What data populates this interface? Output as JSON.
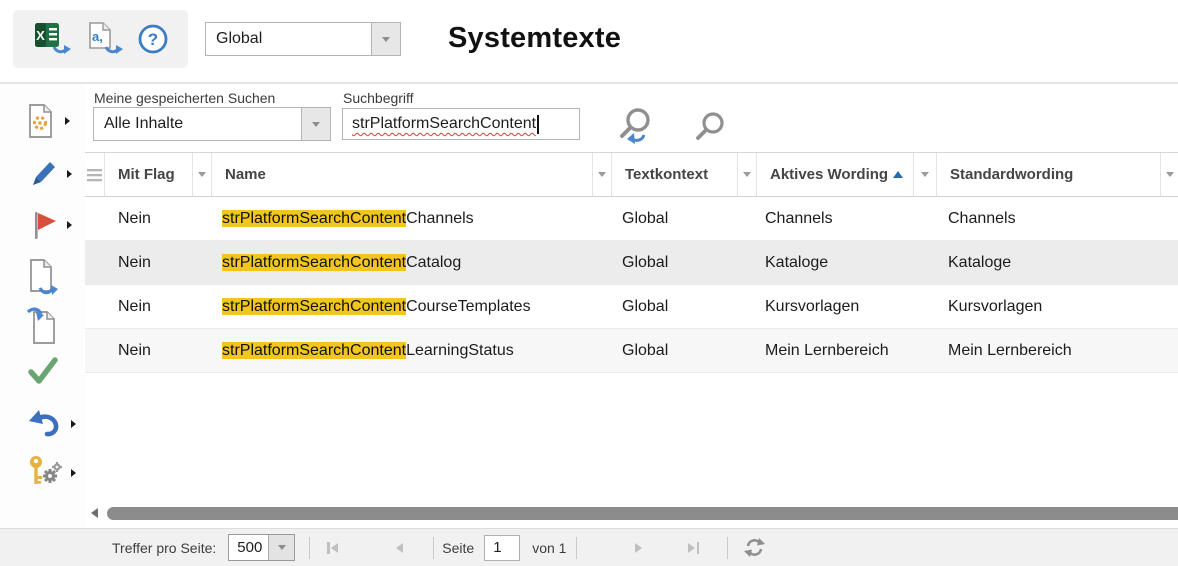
{
  "header": {
    "title": "Systemtexte",
    "context_value": "Global"
  },
  "icons": {
    "excel_glyph": "X",
    "wording_glyph": "a,",
    "help_glyph": "?",
    "toolbar": [
      "excel-export-icon",
      "wording-export-icon",
      "help-icon"
    ],
    "sidebar": [
      "wizard-document-icon",
      "edit-pencil-icon",
      "flag-icon",
      "export-document-icon",
      "import-document-icon",
      "approve-check-icon",
      "undo-icon",
      "administration-key-icon"
    ],
    "footer": [
      "first-page-icon",
      "prev-page-icon",
      "next-page-icon",
      "last-page-icon",
      "refresh-icon"
    ]
  },
  "search": {
    "saved_label": "Meine gespeicherten Suchen",
    "saved_value": "Alle Inhalte",
    "term_label": "Suchbegriff",
    "term_value": "strPlatformSearchContent"
  },
  "table": {
    "columns": [
      {
        "label": "Mit Flag"
      },
      {
        "label": "Name"
      },
      {
        "label": "Textkontext"
      },
      {
        "label": "Aktives Wording",
        "sorted": "ascending"
      },
      {
        "label": "Standardwording"
      }
    ],
    "rows": [
      {
        "flag": "Nein",
        "name_prefix": "strPlatformSearchContent",
        "name_suffix": "Channels",
        "context": "Global",
        "active": "Channels",
        "standard": "Channels"
      },
      {
        "flag": "Nein",
        "name_prefix": "strPlatformSearchContent",
        "name_suffix": "Catalog",
        "context": "Global",
        "active": "Kataloge",
        "standard": "Kataloge"
      },
      {
        "flag": "Nein",
        "name_prefix": "strPlatformSearchContent",
        "name_suffix": "CourseTemplates",
        "context": "Global",
        "active": "Kursvorlagen",
        "standard": "Kursvorlagen"
      },
      {
        "flag": "Nein",
        "name_prefix": "strPlatformSearchContent",
        "name_suffix": "LearningStatus",
        "context": "Global",
        "active": "Mein Lernbereich",
        "standard": "Mein Lernbereich"
      }
    ]
  },
  "footer": {
    "per_page_label": "Treffer pro Seite:",
    "per_page_value": "500",
    "page_label": "Seite",
    "page_value": "1",
    "page_of": "von 1"
  },
  "colors": {
    "highlight": "#F2C51F",
    "sort_arrow": "#1E6EB5",
    "accent_blue": "#4B86CE",
    "row_alt": "#ECECEC"
  }
}
